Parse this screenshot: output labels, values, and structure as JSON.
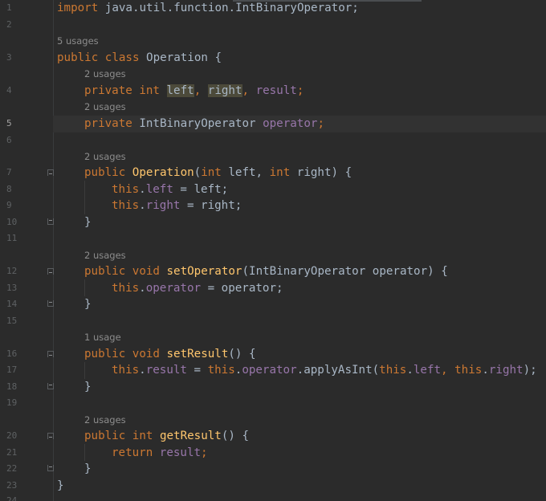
{
  "editor": {
    "current_line": "5",
    "lines": [
      {
        "num": "1"
      },
      {
        "num": "2"
      },
      {
        "num": "3"
      },
      {
        "num": "4"
      },
      {
        "num": "5"
      },
      {
        "num": "6"
      },
      {
        "num": "7"
      },
      {
        "num": "8"
      },
      {
        "num": "9"
      },
      {
        "num": "10"
      },
      {
        "num": "11"
      },
      {
        "num": "12"
      },
      {
        "num": "13"
      },
      {
        "num": "14"
      },
      {
        "num": "15"
      },
      {
        "num": "16"
      },
      {
        "num": "17"
      },
      {
        "num": "18"
      },
      {
        "num": "19"
      },
      {
        "num": "20"
      },
      {
        "num": "21"
      },
      {
        "num": "22"
      },
      {
        "num": "23"
      },
      {
        "num": "24"
      }
    ]
  },
  "hints": {
    "class_usages": "5 usages",
    "fields_usages": "2 usages",
    "operator_field_usages": "2 usages",
    "constructor_usages": "2 usages",
    "set_operator_usages": "2 usages",
    "set_result_usages": "1 usage",
    "get_result_usages": "2 usages"
  },
  "code": {
    "l1_kw": "import",
    "l1_rest": " java.util.function.IntBinaryOperator;",
    "l3_kw": "public class",
    "l3_rest": " Operation {",
    "l4_kw": "private int",
    "l4_left": "left",
    "l4_comma1": ", ",
    "l4_right": "right",
    "l4_comma2": ", ",
    "l4_result": "result",
    "l4_semi": ";",
    "l5_kw": "private",
    "l5_type": " IntBinaryOperator ",
    "l5_field": "operator",
    "l5_semi": ";",
    "l7_kw": "public",
    "l7_name": "Operation",
    "l7_p1": "(",
    "l7_int1": "int",
    "l7_a1": " left, ",
    "l7_int2": "int",
    "l7_a2": " right) {",
    "l8_this": "this",
    "l8_dot": ".",
    "l8_field": "left",
    "l8_rest": " = left;",
    "l9_this": "this",
    "l9_dot": ".",
    "l9_field": "right",
    "l9_rest": " = right;",
    "l10": "}",
    "l12_kw": "public void",
    "l12_name": "setOperator",
    "l12_rest": "(IntBinaryOperator operator) {",
    "l13_this": "this",
    "l13_dot": ".",
    "l13_field": "operator",
    "l13_rest": " = operator;",
    "l14": "}",
    "l16_kw": "public void",
    "l16_name": "setResult",
    "l16_rest": "() {",
    "l17_this1": "this",
    "l17_dot1": ".",
    "l17_f1": "result",
    "l17_eq": " = ",
    "l17_this2": "this",
    "l17_dot2": ".",
    "l17_f2": "operator",
    "l17_call": ".applyAsInt(",
    "l17_this3": "this",
    "l17_dot3": ".",
    "l17_f3": "left",
    "l17_comma": ", ",
    "l17_this4": "this",
    "l17_dot4": ".",
    "l17_f4": "right",
    "l17_end": ");",
    "l18": "}",
    "l20_kw": "public int",
    "l20_name": "getResult",
    "l20_rest": "() {",
    "l21_kw": "return",
    "l21_field": "result",
    "l21_semi": ";",
    "l22": "}",
    "l23": "}"
  }
}
